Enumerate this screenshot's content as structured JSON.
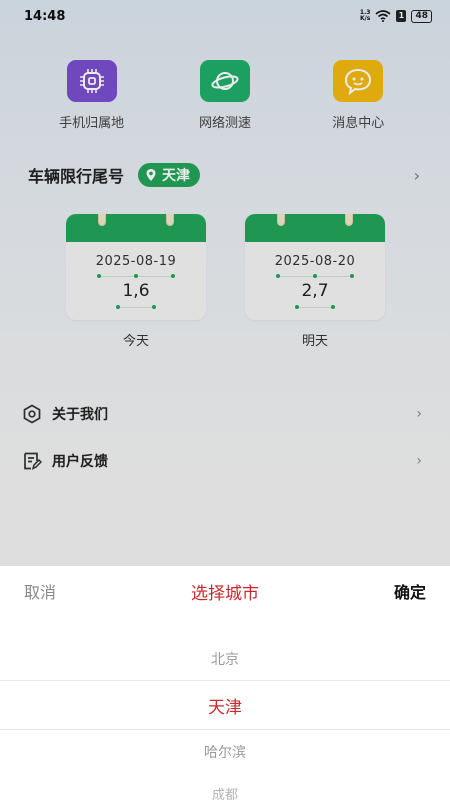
{
  "status": {
    "time": "14:48",
    "net_speed_top": "1.3",
    "net_speed_bottom": "K/s",
    "vibrate_badge": "1",
    "battery": "48"
  },
  "quick_actions": [
    {
      "label": "手机归属地",
      "icon": "chip-icon",
      "color": "#7a4fcf"
    },
    {
      "label": "网络测速",
      "icon": "planet-icon",
      "color": "#1fae6a"
    },
    {
      "label": "消息中心",
      "icon": "chat-icon",
      "color": "#f1b90f"
    }
  ],
  "restriction": {
    "title": "车辆限行尾号",
    "city": "天津",
    "days": [
      {
        "date": "2025-08-19",
        "numbers": "1,6",
        "label": "今天"
      },
      {
        "date": "2025-08-20",
        "numbers": "2,7",
        "label": "明天"
      }
    ]
  },
  "menu": [
    {
      "label": "关于我们",
      "icon": "settings-hex-icon"
    },
    {
      "label": "用户反馈",
      "icon": "feedback-icon"
    }
  ],
  "picker": {
    "cancel": "取消",
    "title": "选择城市",
    "confirm": "确定",
    "options": [
      "北京",
      "天津",
      "哈尔滨",
      "成都"
    ],
    "selected": "天津"
  },
  "colors": {
    "accent_green": "#22a35a",
    "picker_red": "#c9292b"
  }
}
